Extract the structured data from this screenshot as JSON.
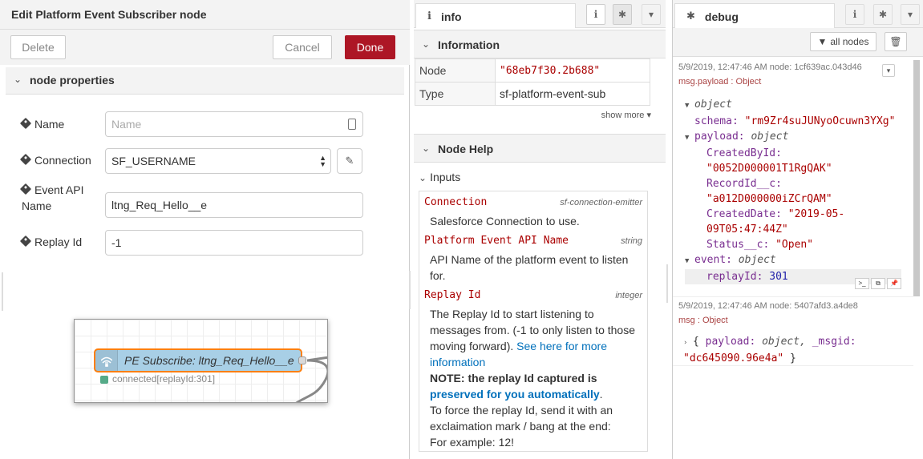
{
  "editor": {
    "title": "Edit Platform Event Subscriber node",
    "delete_label": "Delete",
    "cancel_label": "Cancel",
    "done_label": "Done",
    "section_label": "node properties",
    "fields": {
      "name_label": "Name",
      "name_placeholder": "Name",
      "connection_label": "Connection",
      "connection_value": "SF_USERNAME",
      "event_api_label_line1": "Event API",
      "event_api_label_line2": "Name",
      "event_api_value": "ltng_Req_Hello__e",
      "replay_label": "Replay Id",
      "replay_value": "-1"
    },
    "preview": {
      "node_label": "PE Subscribe: ltng_Req_Hello__e",
      "status_text": "connected[replayId:301]"
    }
  },
  "info": {
    "tab_label": "info",
    "information_label": "Information",
    "rows": [
      {
        "key": "Node",
        "value": "\"68eb7f30.2b688\""
      },
      {
        "key": "Type",
        "value": "sf-platform-event-sub"
      }
    ],
    "show_more": "show more",
    "node_help_label": "Node Help",
    "inputs_label": "Inputs",
    "help": {
      "connection_name": "Connection",
      "connection_type": "sf-connection-emitter",
      "connection_desc": "Salesforce Connection to use.",
      "pe_name": "Platform Event API Name",
      "pe_type": "string",
      "pe_desc_1": "API Name of the platform event to listen",
      "pe_desc_2": "for.",
      "replay_name": "Replay Id",
      "replay_type": "integer",
      "replay_desc_1": "The Replay Id to start listening to",
      "replay_desc_2": "messages from. (-1 to only listen to those",
      "replay_desc_3a": "moving forward).",
      "replay_link_1": "See here for more",
      "replay_link_2": "information",
      "note_a": "NOTE: the replay Id captured is",
      "note_b": "preserved for you automatically",
      "note_c": ".",
      "force_1": "To force the replay Id, send it with an",
      "force_2": "exclaimation mark / bang at the end:",
      "force_3": "For example: 12!"
    }
  },
  "debug": {
    "tab_label": "debug",
    "filter_label": "all nodes",
    "messages": [
      {
        "meta": "5/9/2019, 12:47:46 AM   node: 1cf639ac.043d46",
        "topic": "msg.payload : Object",
        "tree": {
          "object": "object",
          "schema_key": "schema:",
          "schema_val": "\"rm9Zr4suJUNyoOcuwn3YXg\"",
          "payload_key": "payload:",
          "payload_type": "object",
          "createdbyid_key": "CreatedById:",
          "createdbyid_val": "\"0052D000001T1RgQAK\"",
          "recordid_key": "RecordId__c:",
          "recordid_val": "\"a012D000000iZCrQAM\"",
          "createddate_key": "CreatedDate:",
          "createddate_val_1": "\"2019-05-",
          "createddate_val_2": "09T05:47:44Z\"",
          "status_key": "Status__c:",
          "status_val": "\"Open\"",
          "event_key": "event:",
          "event_type": "object",
          "replayid_key": "replayId:",
          "replayid_val": "301"
        }
      },
      {
        "meta": "5/9/2019, 12:47:46 AM   node: 5407afd3.a4de8",
        "topic": "msg : Object",
        "summary_1a": "{ ",
        "summary_1b": "payload:",
        "summary_1c": " object, ",
        "summary_1d": "_msgid:",
        "summary_2": "\"dc645090.96e4a\"",
        "summary_3": " }"
      }
    ]
  },
  "colors": {
    "done_button": "#ad1625",
    "node_fill": "#a8cfe6",
    "node_selected_border": "#ff7f0e",
    "link": "#0070bb"
  }
}
